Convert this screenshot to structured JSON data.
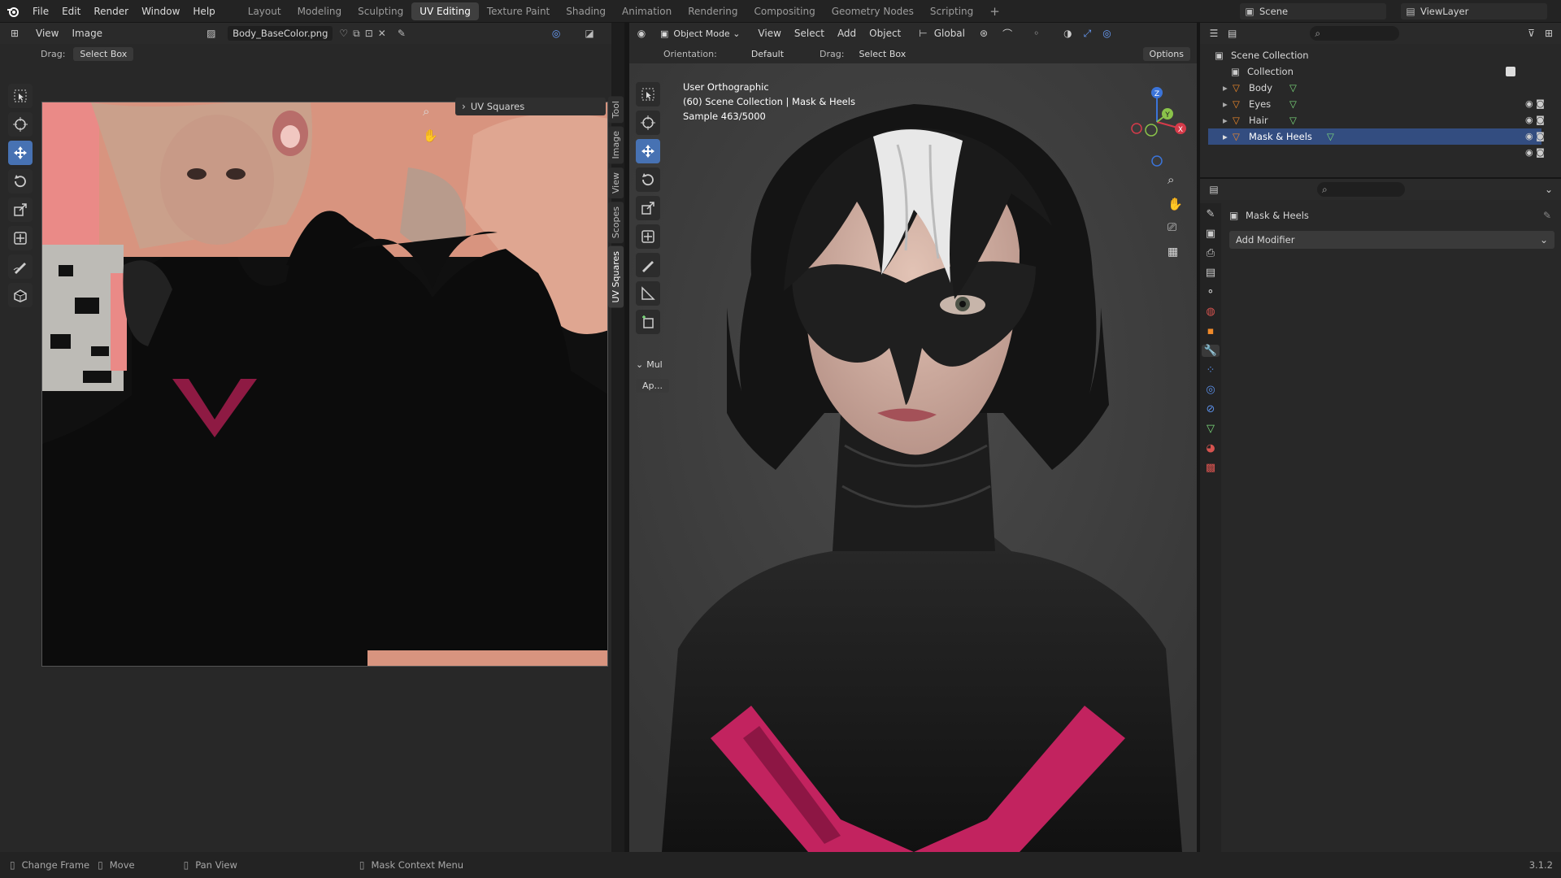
{
  "menu": [
    "File",
    "Edit",
    "Render",
    "Window",
    "Help"
  ],
  "workspaces": [
    {
      "label": "Layout",
      "active": false
    },
    {
      "label": "Modeling",
      "active": false
    },
    {
      "label": "Sculpting",
      "active": false
    },
    {
      "label": "UV Editing",
      "active": true
    },
    {
      "label": "Texture Paint",
      "active": false
    },
    {
      "label": "Shading",
      "active": false
    },
    {
      "label": "Animation",
      "active": false
    },
    {
      "label": "Rendering",
      "active": false
    },
    {
      "label": "Compositing",
      "active": false
    },
    {
      "label": "Geometry Nodes",
      "active": false
    },
    {
      "label": "Scripting",
      "active": false
    }
  ],
  "scene": {
    "name": "Scene",
    "view_layer": "ViewLayer"
  },
  "uv_editor": {
    "view_label": "View",
    "image_label": "Image",
    "image_name": "Body_BaseColor.png",
    "drag_label": "Drag:",
    "drag_value": "Select Box",
    "panel_title": "UV Squares",
    "side_tabs": [
      "Tool",
      "Image",
      "View",
      "Scopes",
      "UV Squares"
    ]
  },
  "viewport": {
    "mode": "Object Mode",
    "menus": [
      "View",
      "Select",
      "Add",
      "Object"
    ],
    "transform": "Global",
    "orientation_label": "Orientation:",
    "orientation_value": "Default",
    "drag_label": "Drag:",
    "drag_value": "Select Box",
    "options": "Options",
    "overlay_line1": "User Orthographic",
    "overlay_line2": "(60) Scene Collection | Mask & Heels",
    "overlay_line3": "Sample 463/5000",
    "last_op_title": "Mul",
    "last_op_btn": "Ap..."
  },
  "outliner": {
    "root": "Scene Collection",
    "collection": "Collection",
    "items": [
      "Body",
      "Eyes",
      "Hair",
      "Mask & Heels"
    ]
  },
  "properties": {
    "object_name": "Mask & Heels",
    "add_modifier": "Add Modifier"
  },
  "status": {
    "items": [
      "Change Frame",
      "Move",
      "Pan View",
      "Mask Context Menu"
    ],
    "version": "3.1.2"
  },
  "colors": {
    "accent": "#4772b3",
    "magenta": "#c2235f",
    "skin": "#e79a8c"
  }
}
